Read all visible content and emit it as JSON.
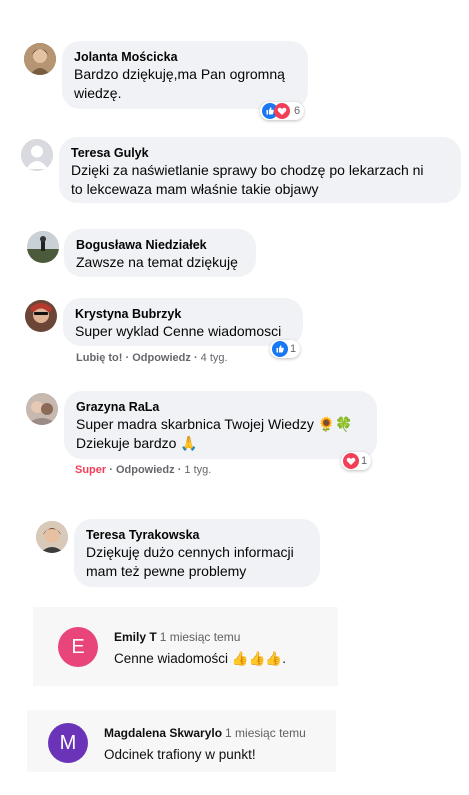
{
  "colors": {
    "bubble": "#f0f2f5",
    "like_blue": "#1877f2",
    "love_red": "#f33e58",
    "muted": "#65676b",
    "avatar_e": "#e8457a",
    "avatar_m": "#6b34b8"
  },
  "comments": [
    {
      "author": "Jolanta Mościcka",
      "lines": [
        "Bardzo dziękuję,ma Pan ogromną",
        "wiedzę."
      ],
      "reaction_count": "6",
      "reaction_icons": [
        "like-icon",
        "love-icon"
      ]
    },
    {
      "author": "Teresa Gulyk",
      "lines": [
        "Dzięki za naświetlanie sprawy bo chodzę po lekarzach ni",
        "to lekcewaza mam właśnie takie objawy"
      ]
    },
    {
      "author": "Bogusława Niedziałek",
      "lines": [
        "Zawsze na temat dziękuję"
      ]
    },
    {
      "author": "Krystyna Bubrzyk",
      "lines": [
        "Super wyklad Cenne wiadomosci"
      ],
      "reaction_count": "1",
      "reaction_icons": [
        "like-icon"
      ],
      "actions": {
        "like": "Lubię to!",
        "reply": "Odpowiedz",
        "time": "4 tyg."
      }
    },
    {
      "author": "Grazyna RaLa",
      "lines": [
        "Super madra skarbnica Twojej Wiedzy 🌻🍀",
        "Dziekuje bardzo 🙏"
      ],
      "reaction_count": "1",
      "reaction_icons": [
        "love-icon"
      ],
      "actions": {
        "like": "Super",
        "reply": "Odpowiedz",
        "time": "1 tyg."
      }
    },
    {
      "author": "Teresa Tyrakowska",
      "lines": [
        "Dziękuję dużo cennych informacji",
        "mam też pewne problemy"
      ]
    }
  ],
  "yt_comments": [
    {
      "avatar_letter": "E",
      "author": "Emily T",
      "time": "1 miesiąc temu",
      "text": "Cenne wiadomości 👍👍👍."
    },
    {
      "avatar_letter": "M",
      "author": "Magdalena Skwarylo",
      "time": "1 miesiąc temu",
      "text": "Odcinek trafiony w punkt!"
    }
  ]
}
